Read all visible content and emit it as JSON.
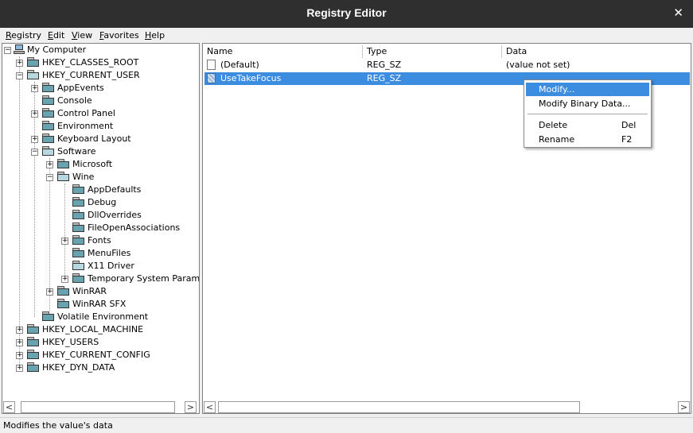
{
  "window": {
    "title": "Registry Editor",
    "close_glyph": "✕"
  },
  "menu": [
    "Registry",
    "Edit",
    "View",
    "Favorites",
    "Help"
  ],
  "tree": {
    "root": "My Computer",
    "hkcr": "HKEY_CLASSES_ROOT",
    "hkcu": "HKEY_CURRENT_USER",
    "hkcu_children": [
      "AppEvents",
      "Console",
      "Control Panel",
      "Environment",
      "Keyboard Layout",
      "Software"
    ],
    "software_children": [
      "Microsoft",
      "Wine"
    ],
    "wine_children": [
      "AppDefaults",
      "Debug",
      "DllOverrides",
      "FileOpenAssociations",
      "Fonts",
      "MenuFiles",
      "X11 Driver",
      "Temporary System Paramete"
    ],
    "software_more": [
      "WinRAR",
      "WinRAR SFX"
    ],
    "volatile": "Volatile Environment",
    "hives": [
      "HKEY_LOCAL_MACHINE",
      "HKEY_USERS",
      "HKEY_CURRENT_CONFIG",
      "HKEY_DYN_DATA"
    ]
  },
  "list": {
    "columns": [
      "Name",
      "Type",
      "Data"
    ],
    "rows": [
      {
        "name": "(Default)",
        "type": "REG_SZ",
        "data": "(value not set)"
      },
      {
        "name": "UseTakeFocus",
        "type": "REG_SZ",
        "data": ""
      }
    ]
  },
  "context_menu": {
    "modify": "Modify...",
    "modify_binary": "Modify Binary Data...",
    "delete": "Delete",
    "delete_key": "Del",
    "rename": "Rename",
    "rename_key": "F2"
  },
  "scroll": {
    "left_arrow": "<",
    "right_arrow": ">"
  },
  "status": "Modifies the value's data"
}
